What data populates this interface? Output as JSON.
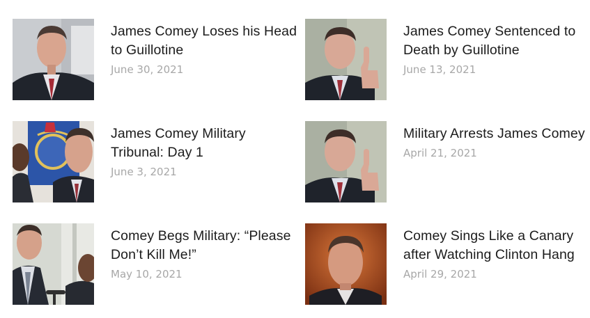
{
  "posts": [
    {
      "title": "James Comey Loses his Head to Guillotine",
      "date": "June 30, 2021",
      "image": "comey-portrait-photo"
    },
    {
      "title": "James Comey Sentenced to Death by Guillotine",
      "date": "June 13, 2021",
      "image": "comey-speaking-gesture-photo"
    },
    {
      "title": "James Comey Military Tribunal: Day 1",
      "date": "June 3, 2021",
      "image": "comey-fbi-flag-photo"
    },
    {
      "title": "Military Arrests James Comey",
      "date": "April 21, 2021",
      "image": "comey-speaking-gesture-photo"
    },
    {
      "title": "Comey Begs Military: “Please Don’t Kill Me!”",
      "date": "May 10, 2021",
      "image": "comey-podium-photo"
    },
    {
      "title": "Comey Sings Like a Canary after Watching Clinton Hang",
      "date": "April 29, 2021",
      "image": "comey-hearing-photo"
    }
  ],
  "colors": {
    "title": "#1c1c1c",
    "date": "#a7a7a7",
    "background": "#ffffff"
  }
}
